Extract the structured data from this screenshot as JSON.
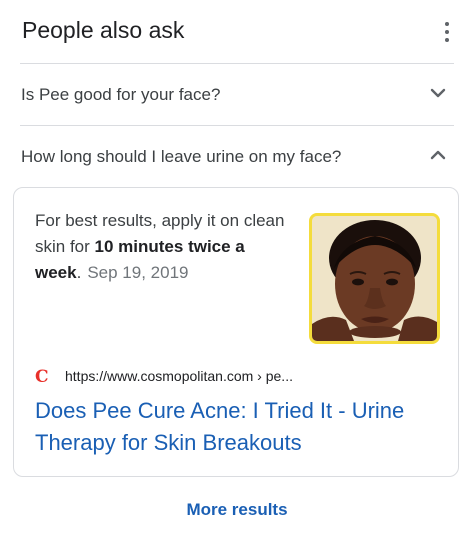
{
  "header": {
    "title": "People also ask"
  },
  "questions": [
    {
      "text": "Is Pee good for your face?",
      "expanded": false
    },
    {
      "text": "How long should I leave urine on my face?",
      "expanded": true
    }
  ],
  "answer": {
    "text_before": "For best results, apply it on clean skin for ",
    "text_bold": "10 minutes twice a week",
    "text_after": ".",
    "date": "Sep 19, 2019",
    "source_favicon": "C",
    "source_url": "https://www.cosmopolitan.com › pe...",
    "result_title": "Does Pee Cure Acne: I Tried It - Urine Therapy for Skin Breakouts"
  },
  "footer": {
    "more_results_label": "More results"
  },
  "colors": {
    "link": "#1a5fb4",
    "divider": "#dadce0",
    "thumb_border": "#f4dc3c",
    "favicon": "#e8302a"
  },
  "icons": {
    "menu": "more-vertical-icon",
    "collapsed": "chevron-down-icon",
    "expanded": "chevron-up-icon"
  }
}
